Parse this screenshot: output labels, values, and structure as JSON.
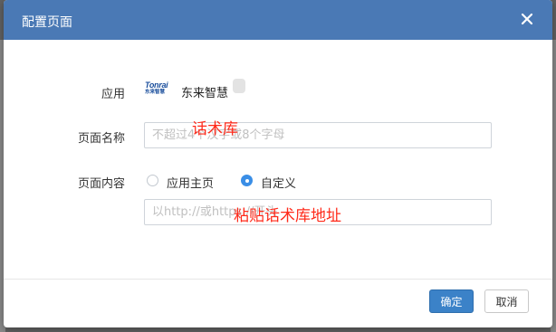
{
  "dialog": {
    "title": "配置页面",
    "close_icon": "close-icon"
  },
  "form": {
    "app_label": "应用",
    "app_logo_top": "Tonrai",
    "app_logo_bottom": "东来智慧",
    "app_name": "东来智慧",
    "page_name_label": "页面名称",
    "page_name_placeholder": "不超过4个汉字或8个字母",
    "page_content_label": "页面内容",
    "radio_homepage": "应用主页",
    "radio_custom": "自定义",
    "selected_option": "自定义",
    "url_placeholder": "以http://或https://开头"
  },
  "annotations": {
    "name_note": "话术库",
    "url_note": "粘贴话术库地址",
    "color": "#ff2a1a"
  },
  "footer": {
    "confirm_label": "确定",
    "cancel_label": "取消"
  },
  "colors": {
    "header": "#4a79b5",
    "primary_button": "#3b82c8",
    "radio_checked": "#3a8ee6"
  }
}
